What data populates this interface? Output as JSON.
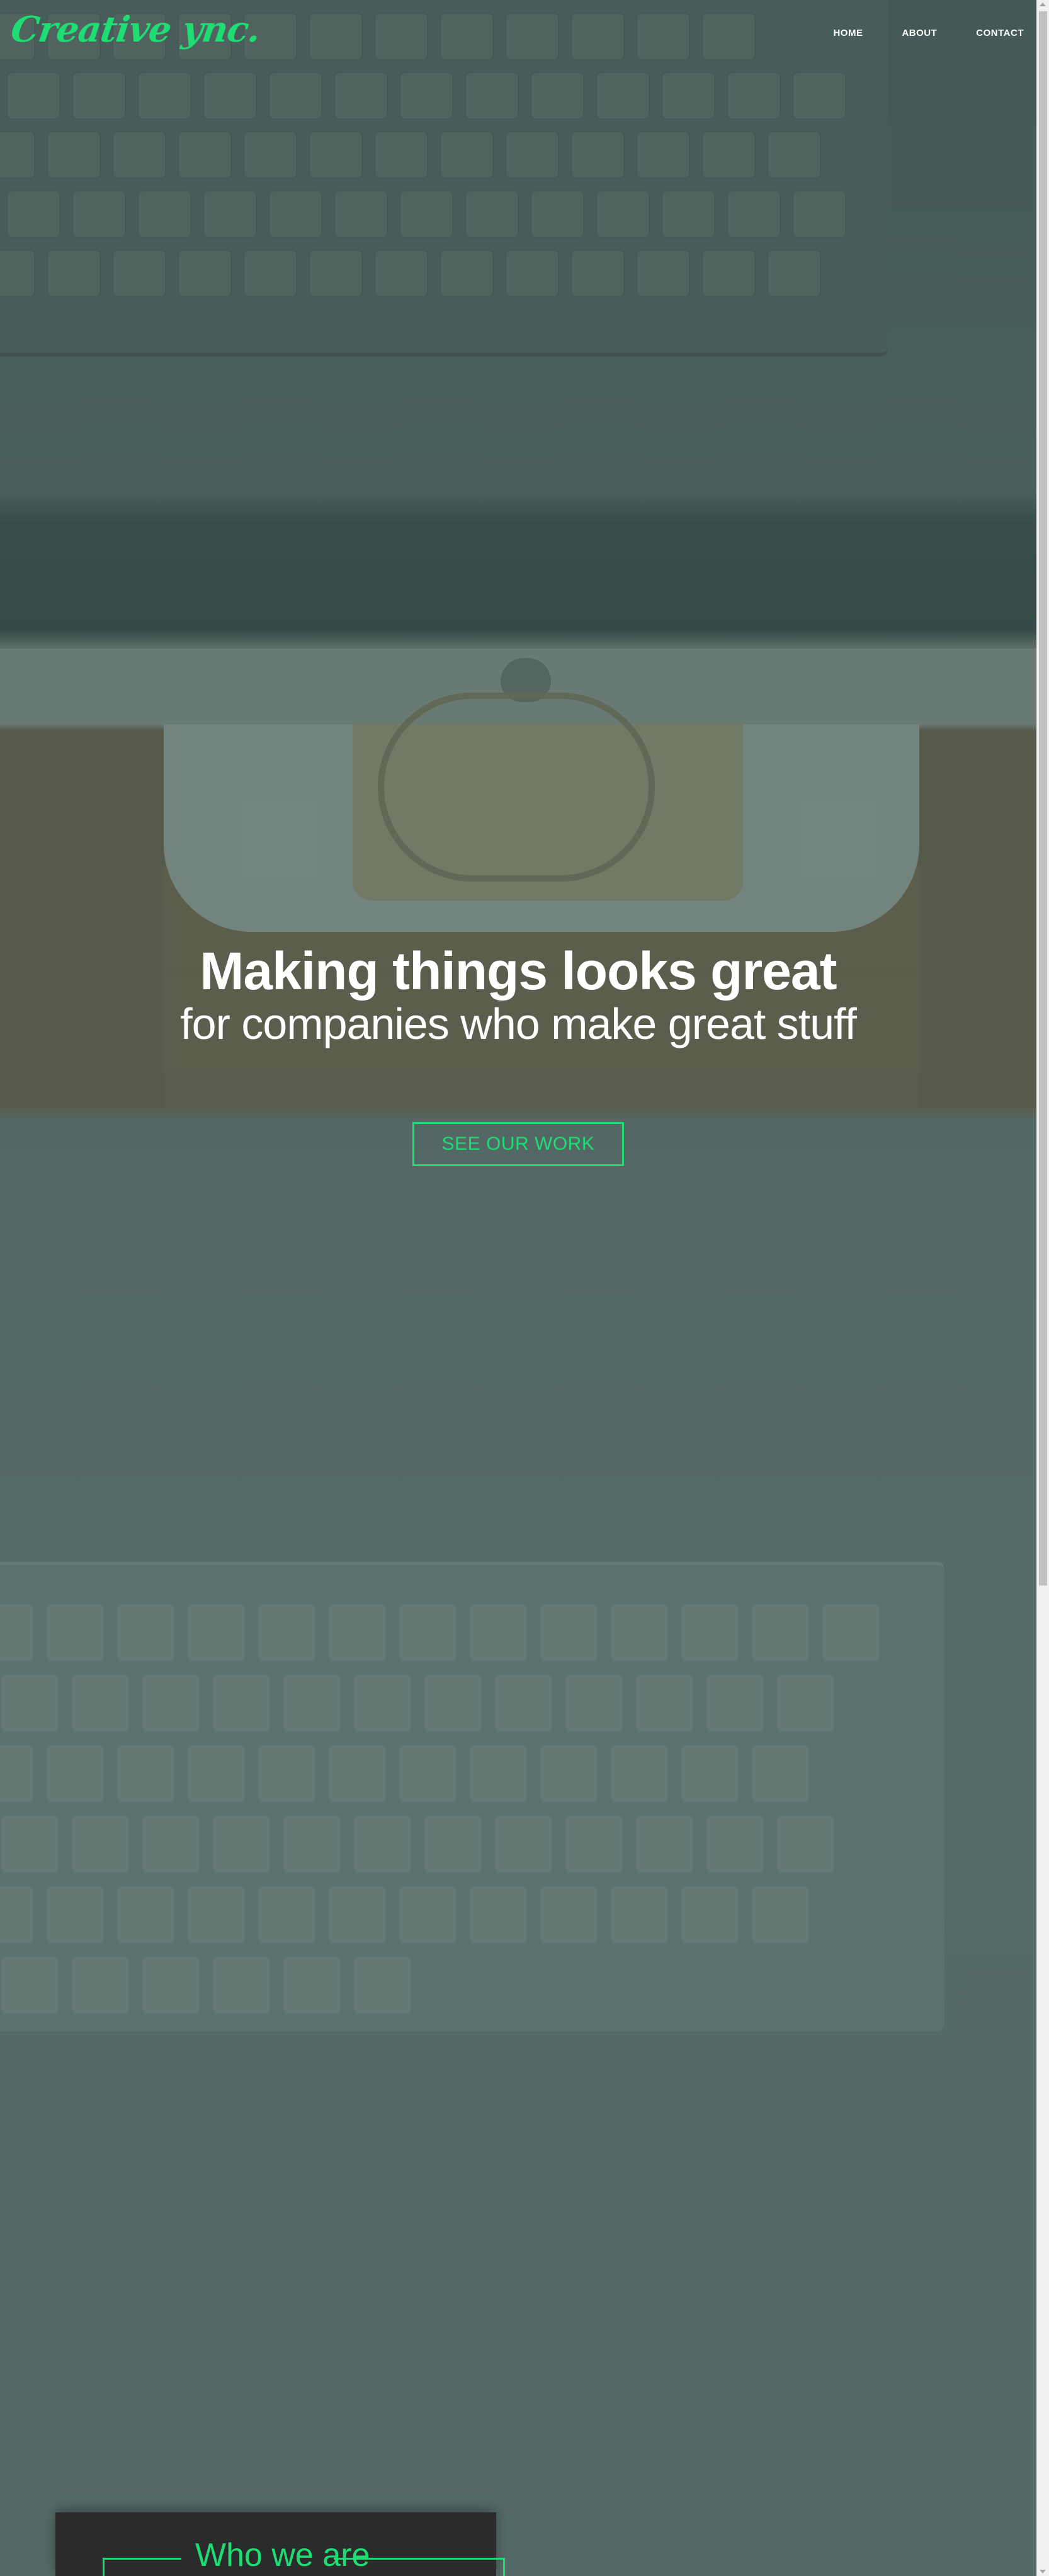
{
  "brand": {
    "logo_text": "Creative ync.",
    "accent_color": "#1fdc73"
  },
  "nav": {
    "items": [
      {
        "label": "HOME"
      },
      {
        "label": "ABOUT"
      },
      {
        "label": "CONTACT"
      }
    ]
  },
  "hero": {
    "title": "Making things looks great",
    "subtitle": "for companies who make great stuff",
    "cta_label": "SEE OUR WORK"
  },
  "about": {
    "heading": "Who we are"
  }
}
